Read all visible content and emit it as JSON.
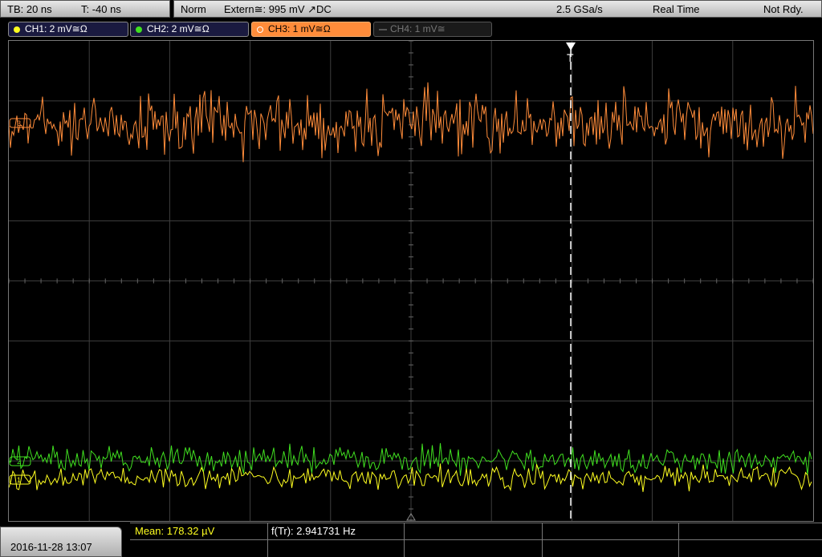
{
  "top": {
    "timebase": "TB: 20 ns",
    "trigger_pos": "T: -40 ns",
    "trigger_mode": "Norm",
    "trigger_source": "Extern≅: 995 mV ↗DC",
    "sample_rate": "2.5 GSa/s",
    "acq_mode": "Real Time",
    "status": "Not Rdy."
  },
  "channels": [
    {
      "label": "CH1: 2 mV≅Ω",
      "color": "#ffff20",
      "active": true
    },
    {
      "label": "CH2: 2 mV≅Ω",
      "color": "#40e020",
      "active": true
    },
    {
      "label": "CH3: 1 mV≅Ω",
      "color": "#ff8c3a",
      "active": true,
      "selected": true
    },
    {
      "label": "CH4: 1 mV≅",
      "color": "#888888",
      "active": false
    }
  ],
  "markers": {
    "ch3": "3",
    "ch2": "2",
    "ch1": "1",
    "trigger": "T"
  },
  "datetime": "2016-11-28 13:07",
  "measurements": {
    "mean": "Mean: 178.32 µV",
    "freq": "f(Tr): 2.941731 Hz"
  },
  "colors": {
    "ch1": "#ffff20",
    "ch2": "#40e020",
    "ch3": "#ff8c3a",
    "grid": "#4a4a4a",
    "trigger": "#ffffff"
  }
}
